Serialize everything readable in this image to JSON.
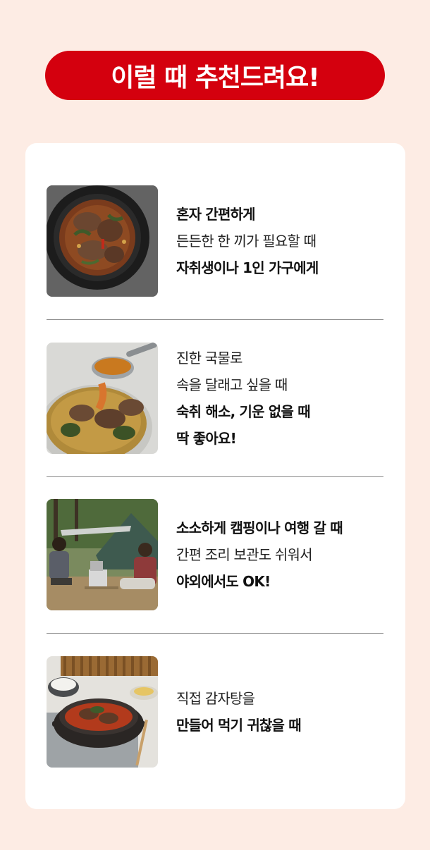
{
  "banner": {
    "title": "이럴 때 추천드려요!"
  },
  "items": [
    {
      "image": "kamjatang-top-view-image",
      "lines": [
        {
          "text": "혼자 간편하게",
          "bold": true
        },
        {
          "text": "든든한 한 끼가 필요할 때",
          "bold": false
        },
        {
          "text": "자취생이나 1인 가구에게",
          "bold": true
        }
      ]
    },
    {
      "image": "ladle-soup-image",
      "lines": [
        {
          "text": "진한 국물로",
          "bold": false
        },
        {
          "text": "속을 달래고 싶을 때",
          "bold": false
        },
        {
          "text": "숙취 해소, 기운 없을 때",
          "bold": true
        },
        {
          "text": "딱 좋아요!",
          "bold": true
        }
      ]
    },
    {
      "image": "camping-image",
      "lines": [
        {
          "text": "소소하게 캠핑이나 여행 갈 때",
          "bold": true
        },
        {
          "text": "간편 조리 보관도 쉬워서",
          "bold": false
        },
        {
          "text": "야외에서도 OK!",
          "bold": true
        }
      ]
    },
    {
      "image": "home-dining-image",
      "lines": [
        {
          "text": "직접 감자탕을",
          "bold": false
        },
        {
          "text": "만들어 먹기 귀찮을 때",
          "bold": true
        }
      ]
    }
  ]
}
